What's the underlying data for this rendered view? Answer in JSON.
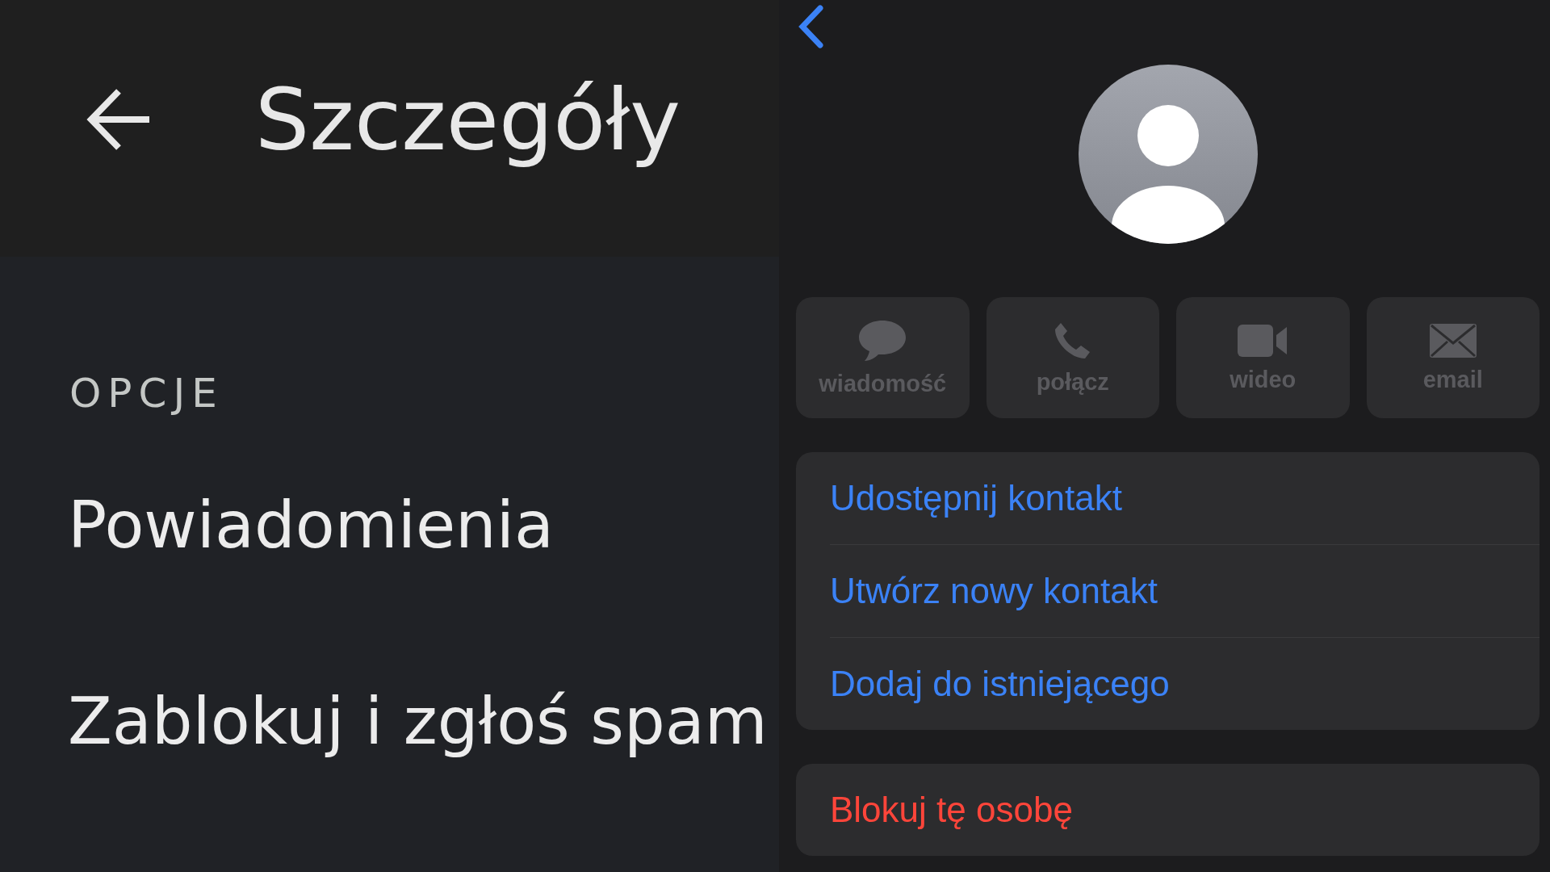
{
  "left_screen": {
    "header": {
      "title": "Szczegóły"
    },
    "section_label": "OPCJE",
    "items": [
      "Powiadomienia",
      "Zablokuj i zgłoś spam"
    ]
  },
  "right_screen": {
    "actions": [
      {
        "kind": "message",
        "label": "wiadomość",
        "disabled": true
      },
      {
        "kind": "call",
        "label": "połącz",
        "disabled": true
      },
      {
        "kind": "video",
        "label": "wideo",
        "disabled": true
      },
      {
        "kind": "email",
        "label": "email",
        "disabled": true
      }
    ],
    "contact_options": [
      "Udostępnij kontakt",
      "Utwórz nowy kontakt",
      "Dodaj do istniejącego"
    ],
    "block_action": "Blokuj tę osobę"
  }
}
